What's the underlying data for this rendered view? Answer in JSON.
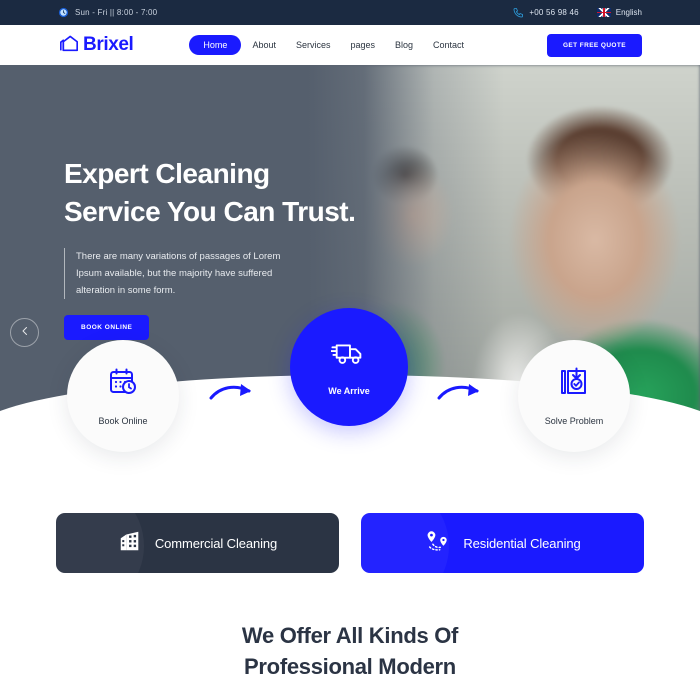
{
  "topbar": {
    "hours_icon": "clock-icon",
    "hours": "Sun - Fri || 8:00 - 7:00",
    "phone_icon": "phone-icon",
    "phone": "+00 56 98 46",
    "flag_icon": "uk-flag-icon",
    "language": "English"
  },
  "navbar": {
    "logo_icon": "house-logo-icon",
    "logo_text": "Brixel",
    "links": [
      {
        "label": "Home",
        "active": true
      },
      {
        "label": "About",
        "active": false
      },
      {
        "label": "Services",
        "active": false
      },
      {
        "label": "pages",
        "active": false
      },
      {
        "label": "Blog",
        "active": false
      },
      {
        "label": "Contact",
        "active": false
      }
    ],
    "quote_button": "GET FREE QUOTE"
  },
  "hero": {
    "heading_line1": "Expert Cleaning",
    "heading_line2": "Service You Can Trust.",
    "paragraph": "There are many variations of passages of Lorem Ipsum available, but the majority have suffered alteration in some form.",
    "book_button": "BOOK ONLINE",
    "prev_arrow_icon": "arrow-left-icon"
  },
  "process": {
    "steps": [
      {
        "label": "Book Online",
        "icon": "calendar-clock-icon",
        "style": "white"
      },
      {
        "label": "We Arrive",
        "icon": "delivery-truck-icon",
        "style": "blue"
      },
      {
        "label": "Solve Problem",
        "icon": "settings-gear-icon",
        "style": "white"
      }
    ],
    "connector_icon": "curved-arrow-icon"
  },
  "cards": [
    {
      "label": "Commercial Cleaning",
      "icon": "office-building-icon",
      "style": "dark"
    },
    {
      "label": "Residential Cleaning",
      "icon": "route-pins-icon",
      "style": "blue"
    }
  ],
  "section_heading": {
    "line1": "We Offer All Kinds Of",
    "line2": "Professional Modern"
  },
  "colors": {
    "brand_blue": "#1a1aff",
    "dark_navy": "#1b2a41",
    "card_dark": "#2b3444",
    "hero_overlay": "#555f6d"
  }
}
